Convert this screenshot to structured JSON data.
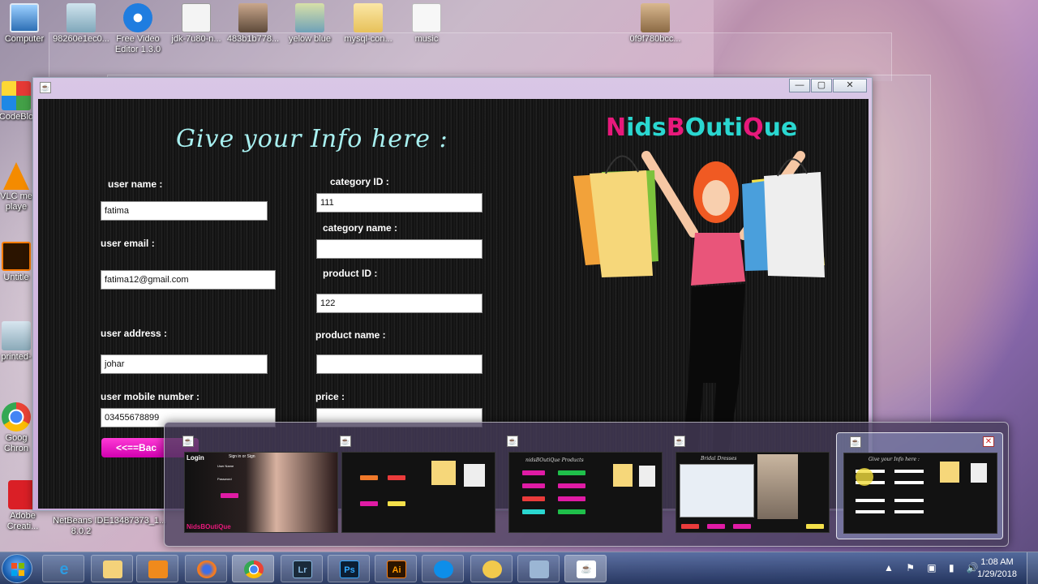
{
  "desktop": {
    "icons": [
      {
        "label": "Computer"
      },
      {
        "label": "98260e1ec0..."
      },
      {
        "label": "Free Video"
      },
      {
        "label": "Editor 1.3.0"
      },
      {
        "label": "jdk-7u80-n..."
      },
      {
        "label": "483b1b778..."
      },
      {
        "label": "yelow blue"
      },
      {
        "label": "mysql-con..."
      },
      {
        "label": "music"
      },
      {
        "label": "0f9f780bcc..."
      },
      {
        "label": "CodeBlo"
      },
      {
        "label": "VLC me"
      },
      {
        "label": "playe"
      },
      {
        "label": "Untitle"
      },
      {
        "label": "printed-"
      },
      {
        "label": "Goog"
      },
      {
        "label": "Chron"
      },
      {
        "label": "Adobe"
      },
      {
        "label": "Creati..."
      },
      {
        "label": "NetBeans IDE"
      },
      {
        "label": "8.0.2"
      },
      {
        "label": "13487373_1..."
      }
    ]
  },
  "app": {
    "heading": "Give your Info here :",
    "brand_part1": "N",
    "brand_part2": "ids",
    "brand_part3": "B",
    "brand_part4": "Outi",
    "brand_part5": "Q",
    "brand_part6": "ue",
    "labels": {
      "user_name": "user name :",
      "user_email": "user email :",
      "user_address": "user address :",
      "user_mobile": "user mobile number :",
      "category_id": "category ID :",
      "category_name": "category name :",
      "product_id": "product ID :",
      "product_name": "product name :",
      "price": "price :"
    },
    "values": {
      "user_name": "fatima",
      "user_email": "fatima12@gmail.com",
      "user_address": "johar",
      "user_mobile": "03455678899",
      "category_id": "111",
      "category_name": "",
      "product_id": "122",
      "product_name": "",
      "price": ""
    },
    "back_button": "<<==Bac",
    "window_buttons": {
      "minimize": "—",
      "maximize": "▢",
      "close": "✕"
    }
  },
  "switcher": {
    "thumb1": {
      "title": "Login",
      "subtitle": "Sign in or Sign",
      "f1": "User Name",
      "f2": "Password",
      "brand": "NidsBOutiQue"
    },
    "thumb3": {
      "title": "nidsBOutiQue Products"
    },
    "thumb4": {
      "title": "Bridal Dresses"
    },
    "thumb5": {
      "title": "Give your Info here :"
    }
  },
  "taskbar": {
    "apps": [
      "ie-icon",
      "explorer-icon",
      "media-player-icon",
      "firefox-icon",
      "chrome-icon",
      "lightroom-icon",
      "photoshop-icon",
      "illustrator-icon",
      "teamviewer-icon",
      "app-icon",
      "virtualbox-icon",
      "java-icon"
    ],
    "lr": "Lr",
    "ps": "Ps",
    "ai": "Ai",
    "time": "1:08 AM",
    "date": "1/29/2018"
  },
  "colors": {
    "accent_pink": "#e8197b",
    "accent_cyan": "#2ad7d0",
    "back_button": "#ff3bd6"
  }
}
